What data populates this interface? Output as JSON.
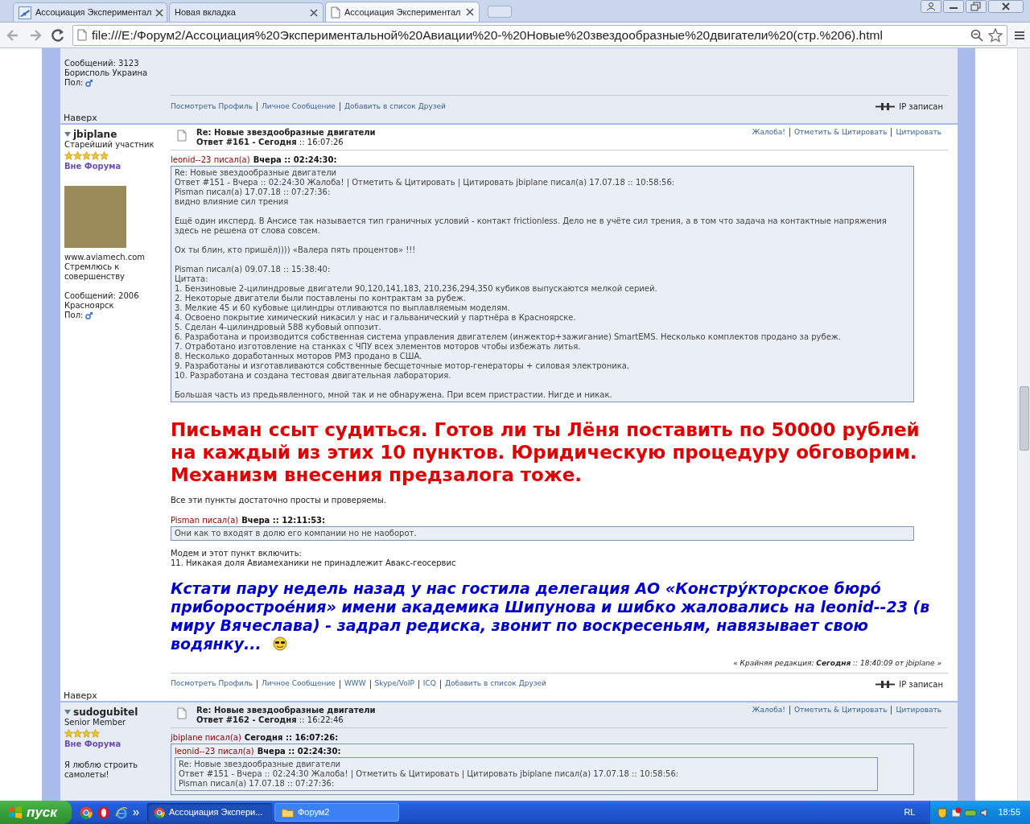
{
  "browser": {
    "tabs": [
      {
        "title": "Ассоциация Экспериментал",
        "selected": false
      },
      {
        "title": "Новая вкладка",
        "selected": false
      },
      {
        "title": "Ассоциация Экспериментал",
        "selected": true
      }
    ],
    "address": "file:///E:/Форум2/Ассоциация%20Экспериментальной%20Авиации%20-%20Новые%20звездообразные%20двигатели%20(стр.%206).html"
  },
  "posts": [
    {
      "author": {
        "stats": [
          "Сообщений: 3123",
          "Борисполь Украина"
        ],
        "gender": "Пол:"
      },
      "footer": {
        "links": [
          "Посмотреть Профиль",
          "Личное Сообщение",
          "Добавить в список Друзей"
        ],
        "ip": "IP записан"
      },
      "top_link": "Наверх"
    },
    {
      "author": {
        "name": "jbiplane",
        "rank": "Старейший участник",
        "stars": 5,
        "status": "Вне Форума",
        "avatar": true,
        "info": [
          "www.aviamech.com",
          "Стремлюсь к совершенству"
        ],
        "stats": [
          "Сообщений: 2006",
          "Красноярск"
        ],
        "gender": "Пол:"
      },
      "header": {
        "title": "Re: Новые звездообразные двигатели",
        "meta": "**Ответ #161 - Сегодня** :: 16:07:26",
        "actions": [
          "Жалоба!",
          "Отметить & Цитировать",
          "Цитировать"
        ]
      },
      "blocks": [
        {
          "kind": "quote",
          "author": "leonid--23 писал(а)",
          "when": "Вчера :: 02:24:30:",
          "blocks": [
            {
              "kind": "paragraph",
              "lines": [
                "Re: Новые звездообразные двигатели",
                "Ответ #151 - Вчера :: 02:24:30 Жалоба! | Отметить & Цитировать | Цитировать  jbiplane писал(а) 17.07.18 :: 10:58:56:",
                "Pisman писал(а) 17.07.18 :: 07:27:36:",
                "видно влияние сил трения"
              ]
            },
            {
              "kind": "paragraph",
              "lines": [
                "Ещё один иксперд. В Ансисе так называется тип граничных условий - контакт frictionless. Дело не в учёте сил трения, а в том что задача на контактные напряжения здесь не решена от слова совсем."
              ]
            },
            {
              "kind": "paragraph",
              "lines": [
                "Ох ты блин, кто пришёл)))) «Валера пять процентов» !!!"
              ]
            },
            {
              "kind": "paragraph",
              "lines": [
                "Pisman писал(а) 09.07.18 :: 15:38:40:",
                "Цитата:",
                "1. Бензиновые 2-цилиндровые двигатели 90,120,141,183, 210,236,294,350 кубиков выпускаются мелкой серией.",
                "2. Некоторые двигатели были поставлены по контрактам за рубеж.",
                "3. Мелкие 45 и 60 кубовые цилиндры отливаются по выплавляемым моделям.",
                "4. Освоено покрытие химический никасил у нас и гальванический у партнёра в Красноярске.",
                "5. Сделан 4-цилиндровый 588 кубовый оппозит.",
                "6. Разработана и производится собственная система управления двигателем (инжектор+зажигание) SmartEMS. Несколько комплектов продано за рубеж.",
                "7. Отработано изготовление на станках с ЧПУ всех элементов моторов чтобы избежать литья.",
                "8. Несколько доработанных моторов РМЗ продано в США.",
                "9. Разработаны и изготавливаются собственные бесщеточные мотор-генераторы + силовая электроника.",
                "10. Разработана и создана тестовая двигательная лаборатория."
              ]
            },
            {
              "kind": "paragraph",
              "lines": [
                "Большая часть из предьявленного, мной так и не обнаружена. При всем пристрастии. Нигде и никак."
              ]
            }
          ]
        },
        {
          "kind": "shout",
          "text": "Письман ссыт судиться. Готов ли ты Лёня поставить по 50000 рублей на каждый из этих 10 пунктов. Юридическую процедуру обговорим. Механизм внесения предзалога тоже."
        },
        {
          "kind": "paragraph",
          "lines": [
            "Все эти пункты достаточно просты и проверяемы."
          ]
        },
        {
          "kind": "quote",
          "author": "Pisman писал(а)",
          "when": "Вчера :: 12:11:53:",
          "blocks": [
            {
              "kind": "paragraph",
              "lines": [
                "Они как то входят в долю его компании но не наоборот."
              ]
            }
          ]
        },
        {
          "kind": "paragraph",
          "lines": [
            "Модем и этот пункт включить:",
            "11. Никакая доля Авиамеханики не принадлежит Авакс-геосервис"
          ]
        },
        {
          "kind": "highlight",
          "text": "Кстати пару недель назад у нас гостила делегация АО «Констру́кторское бюро́ приборострое́ния» имени академика Шипунова и шибко жаловались на leonid--23 (в миру Вячеслава) - задрал редиска, звонит по воскресеньям, навязывает свою водянку...",
          "emoticon": true
        }
      ],
      "edit_note": "« Крайняя редакция: **Сегодня** :: 18:40:09 от jbiplane »",
      "footer": {
        "links": [
          "Посмотреть Профиль",
          "Личное Сообщение",
          "WWW",
          "Skype/VoIP",
          "ICQ",
          "Добавить в список Друзей"
        ],
        "ip": "IP записан"
      },
      "top_link": "Наверх"
    },
    {
      "author": {
        "name": "sudogubitel",
        "rank": "Senior Member",
        "stars": 4,
        "status": "Вне Форума",
        "info": [
          "Я люблю строить самолеты!"
        ]
      },
      "header": {
        "title": "Re: Новые звездообразные двигатели",
        "meta": "**Ответ #162 - Сегодня** :: 16:22:46",
        "actions": [
          "Жалоба!",
          "Отметить & Цитировать",
          "Цитировать"
        ]
      },
      "blocks": [
        {
          "kind": "quote",
          "author": "jbiplane писал(а)",
          "when": "Сегодня :: 16:07:26:",
          "blocks": [
            {
              "kind": "quote",
              "author": "leonid--23 писал(а)",
              "when": "Вчера :: 02:24:30:",
              "blocks": [
                {
                  "kind": "paragraph",
                  "lines": [
                    "Re: Новые звездообразные двигатели",
                    "Ответ #151 - Вчера :: 02:24:30 Жалоба! | Отметить & Цитировать | Цитировать  jbiplane писал(а) 17.07.18 :: 10:58:56:",
                    "Pisman писал(а) 17.07.18 :: 07:27:36:"
                  ]
                }
              ]
            }
          ]
        }
      ]
    }
  ],
  "taskbar": {
    "start": "пуск",
    "windows": [
      {
        "title": "Ассоциация Экспери...",
        "selected": true
      },
      {
        "title": "Форум2",
        "selected": false
      }
    ],
    "language": "RL",
    "time": "18:55"
  }
}
